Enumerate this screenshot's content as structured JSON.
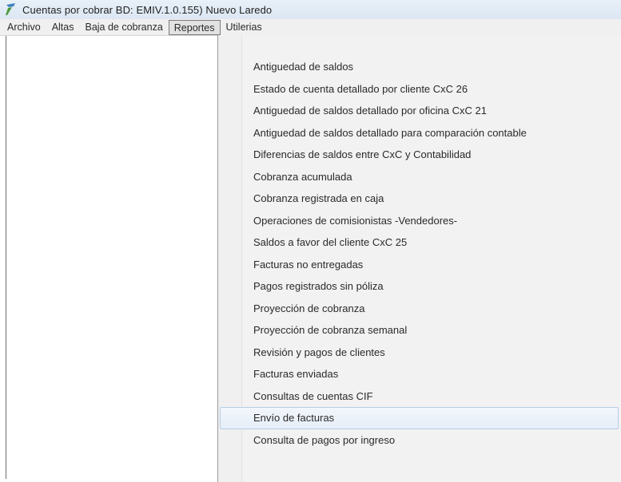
{
  "window": {
    "title": "Cuentas por cobrar  BD: EMIV.1.0.155)  Nuevo Laredo"
  },
  "menubar": {
    "items": [
      {
        "label": "Archivo"
      },
      {
        "label": "Altas"
      },
      {
        "label": "Baja de cobranza"
      },
      {
        "label": "Reportes",
        "active": true
      },
      {
        "label": "Utilerias"
      }
    ]
  },
  "reportes_menu": {
    "items": [
      {
        "label": "Antiguedad de saldos"
      },
      {
        "label": "Estado de cuenta detallado por cliente CxC 26"
      },
      {
        "label": "Antiguedad de saldos detallado por oficina CxC 21"
      },
      {
        "label": "Antiguedad de saldos detallado para comparación contable"
      },
      {
        "label": "Diferencias de saldos entre CxC y Contabilidad"
      },
      {
        "label": "Cobranza acumulada"
      },
      {
        "label": "Cobranza registrada en caja"
      },
      {
        "label": "Operaciones de comisionistas -Vendedores-"
      },
      {
        "label": "Saldos a favor del cliente CxC 25"
      },
      {
        "label": "Facturas no entregadas"
      },
      {
        "label": "Pagos registrados sin póliza"
      },
      {
        "label": "Proyección de cobranza"
      },
      {
        "label": "Proyección de cobranza semanal"
      },
      {
        "label": "Revisión y pagos de clientes"
      },
      {
        "label": "Facturas enviadas"
      },
      {
        "label": "Consultas de cuentas CIF"
      },
      {
        "label": "Envío de facturas",
        "highlighted": true
      },
      {
        "label": "Consulta de pagos por ingreso"
      }
    ]
  },
  "icons": {
    "app": "app-logo-icon"
  },
  "colors": {
    "titlebar": "#dce7f3",
    "menubar": "#f0f0f0",
    "dropdown": "#f2f2f2",
    "highlight_border": "#b9cde5"
  }
}
